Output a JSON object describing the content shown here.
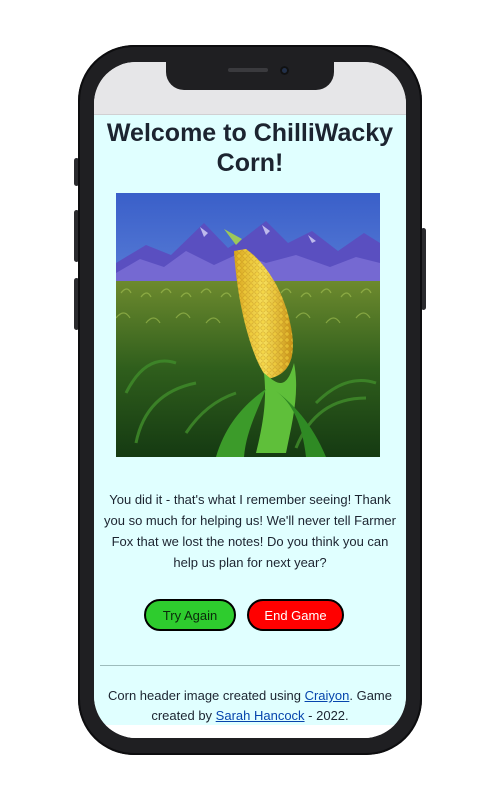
{
  "page": {
    "title": "Welcome to ChilliWacky Corn!",
    "message": "You did it - that's what I remember seeing! Thank you so much for helping us! We'll never tell Farmer Fox that we lost the notes! Do you think you can help us plan for next year?",
    "hero_image": "corn-field-mountains-image"
  },
  "buttons": {
    "try_again": "Try Again",
    "end_game": "End Game"
  },
  "footer": {
    "text_1": "Corn header image created using ",
    "link_1": "Craiyon",
    "text_2": ". Game created by ",
    "link_2": "Sarah Hancock",
    "text_3": " - 2022."
  },
  "colors": {
    "page_background": "#e0ffff",
    "try_again": "#2ecc2e",
    "end_game": "#ff0000",
    "link": "#0645ad"
  }
}
